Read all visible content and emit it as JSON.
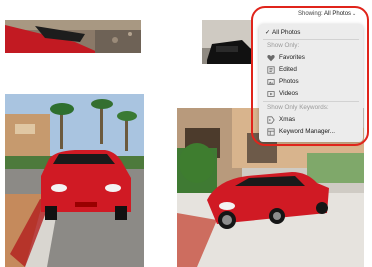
{
  "showing": {
    "label": "Showing:",
    "value": "All Photos"
  },
  "menu": {
    "checked_item": "All Photos",
    "show_only_header": "Show Only:",
    "show_only_items": [
      {
        "label": "Favorites",
        "icon": "heart-icon"
      },
      {
        "label": "Edited",
        "icon": "edited-icon"
      },
      {
        "label": "Photos",
        "icon": "photo-icon"
      },
      {
        "label": "Videos",
        "icon": "video-icon"
      }
    ],
    "keywords_header": "Show Only Keywords:",
    "keyword_items": [
      {
        "label": "Xmas",
        "icon": "tag-icon"
      },
      {
        "label": "Keyword Manager...",
        "icon": "keyword-manager-icon"
      }
    ]
  },
  "highlight_color": "#e0241b",
  "car_color": "#d01a24"
}
